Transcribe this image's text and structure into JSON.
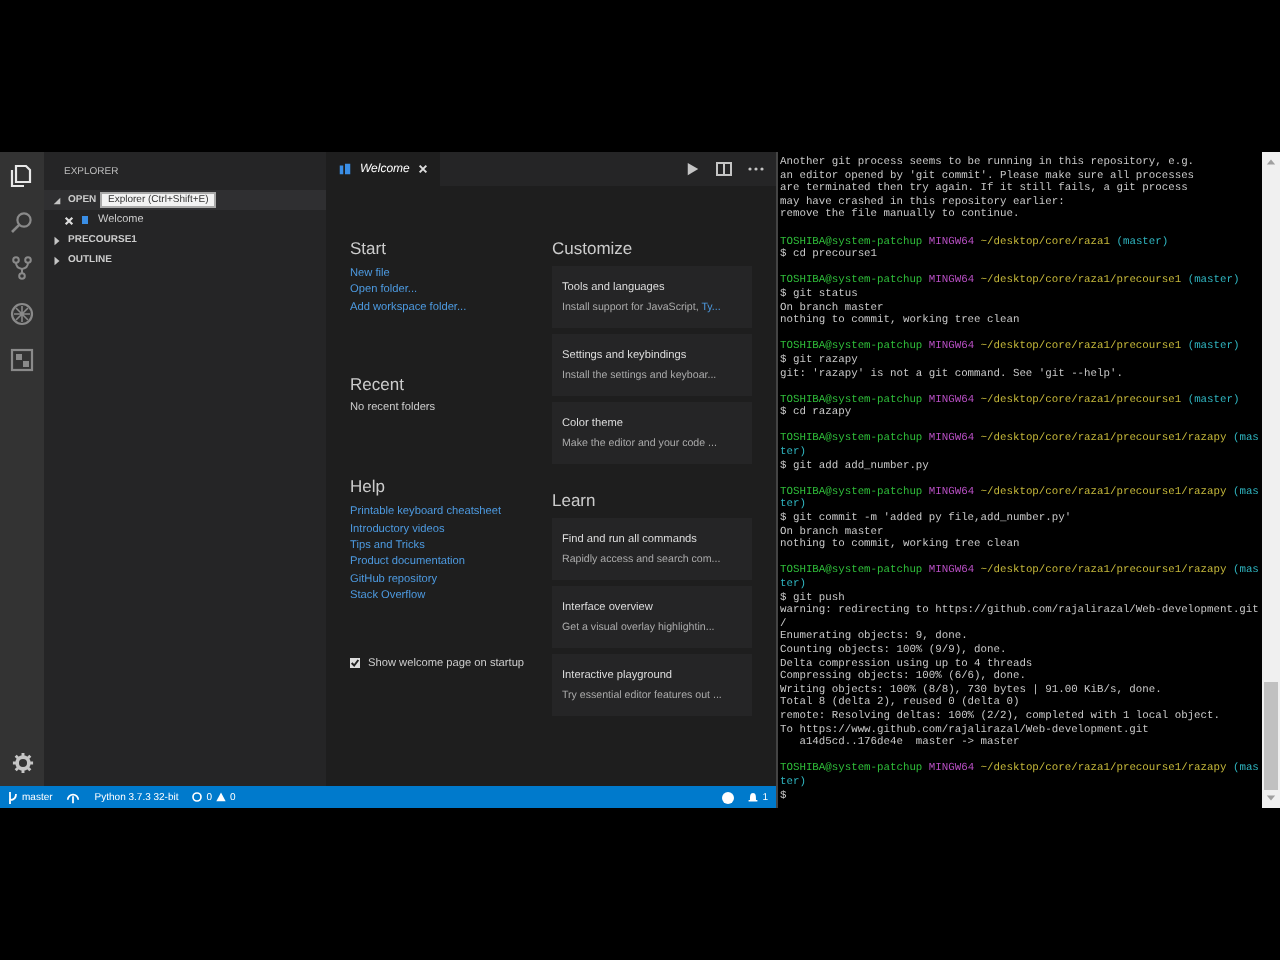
{
  "activity_bar": [
    {
      "kind": "files",
      "selected": true
    },
    {
      "kind": "search",
      "selected": false
    },
    {
      "kind": "source-control",
      "selected": false
    },
    {
      "kind": "debug",
      "selected": false
    },
    {
      "kind": "extensions",
      "selected": false
    }
  ],
  "tooltip": "Explorer (Ctrl+Shift+E)",
  "explorer": {
    "title": "EXPLORER",
    "sections": [
      {
        "label": "OPEN",
        "expanded": true,
        "children": [
          {
            "label": "Welcome"
          }
        ]
      },
      {
        "label": "PRECOURSE1",
        "expanded": false
      },
      {
        "label": "OUTLINE",
        "expanded": false
      }
    ]
  },
  "editor_tab": {
    "label": "Welcome"
  },
  "welcome": {
    "start": {
      "title": "Start",
      "links": [
        "New file",
        "Open folder...",
        "Add workspace folder..."
      ]
    },
    "recent": {
      "title": "Recent",
      "text": "No recent folders"
    },
    "help": {
      "title": "Help",
      "links": [
        "Printable keyboard cheatsheet",
        "Introductory videos",
        "Tips and Tricks",
        "Product documentation",
        "GitHub repository",
        "Stack Overflow"
      ]
    },
    "show_on_startup": {
      "label": "Show welcome page on startup",
      "checked": true
    },
    "customize": {
      "title": "Customize",
      "cards": [
        {
          "title": "Tools and languages",
          "description": "Install support for JavaScript, ",
          "link": "Ty..."
        },
        {
          "title": "Settings and keybindings",
          "description": "Install the settings and keyboar..."
        },
        {
          "title": "Color theme",
          "description": "Make the editor and your code ..."
        }
      ]
    },
    "learn": {
      "title": "Learn",
      "cards": [
        {
          "title": "Find and run all commands",
          "description": "Rapidly access and search com..."
        },
        {
          "title": "Interface overview",
          "description": "Get a visual overlay highlightin..."
        },
        {
          "title": "Interactive playground",
          "description": "Try essential editor features out ..."
        }
      ]
    }
  },
  "status_bar": {
    "branch": "master",
    "python": "Python 3.7.3 32-bit",
    "errors": "0",
    "warnings": "0",
    "notifications": "1"
  },
  "terminal": [
    [
      [
        {
          "kind": "text",
          "text": "Another git process seems to be running in this repository, e.g."
        }
      ],
      [
        {
          "kind": "text",
          "text": "an editor opened by 'git commit'. Please make sure all processes"
        }
      ],
      [
        {
          "kind": "text",
          "text": "are terminated then try again. If it still fails, a git process"
        }
      ],
      [
        {
          "kind": "text",
          "text": "may have crashed in this repository earlier:"
        }
      ],
      [
        {
          "kind": "text",
          "text": "remove the file manually to continue."
        }
      ]
    ],
    [
      [
        {
          "kind": "user",
          "text": "TOSHIBA@system-patchup"
        },
        {
          "kind": "system",
          "text": " MINGW64"
        },
        {
          "kind": "path",
          "text": " ~/desktop/core/raza1"
        },
        {
          "kind": "branch",
          "text": " (master)"
        }
      ],
      [
        {
          "kind": "text",
          "text": "$ cd precourse1"
        }
      ]
    ],
    [
      [
        {
          "kind": "user",
          "text": "TOSHIBA@system-patchup"
        },
        {
          "kind": "system",
          "text": " MINGW64"
        },
        {
          "kind": "path",
          "text": " ~/desktop/core/raza1/precourse1"
        },
        {
          "kind": "branch",
          "text": " (master)"
        }
      ],
      [
        {
          "kind": "text",
          "text": "$ git status"
        }
      ],
      [
        {
          "kind": "text",
          "text": "On branch master"
        }
      ],
      [
        {
          "kind": "text",
          "text": "nothing to commit, working tree clean"
        }
      ]
    ],
    [
      [
        {
          "kind": "user",
          "text": "TOSHIBA@system-patchup"
        },
        {
          "kind": "system",
          "text": " MINGW64"
        },
        {
          "kind": "path",
          "text": " ~/desktop/core/raza1/precourse1"
        },
        {
          "kind": "branch",
          "text": " (master)"
        }
      ],
      [
        {
          "kind": "text",
          "text": "$ git razapy"
        }
      ],
      [
        {
          "kind": "text",
          "text": "git: 'razapy' is not a git command. See 'git --help'."
        }
      ]
    ],
    [
      [
        {
          "kind": "user",
          "text": "TOSHIBA@system-patchup"
        },
        {
          "kind": "system",
          "text": " MINGW64"
        },
        {
          "kind": "path",
          "text": " ~/desktop/core/raza1/precourse1"
        },
        {
          "kind": "branch",
          "text": " (master)"
        }
      ],
      [
        {
          "kind": "text",
          "text": "$ cd razapy"
        }
      ]
    ],
    [
      [
        {
          "kind": "user",
          "text": "TOSHIBA@system-patchup"
        },
        {
          "kind": "system",
          "text": " MINGW64"
        },
        {
          "kind": "path",
          "text": " ~/desktop/core/raza1/precourse1/razapy"
        },
        {
          "kind": "branch",
          "text": " (mas"
        }
      ],
      [
        {
          "kind": "branch",
          "text": "ter)"
        }
      ],
      [
        {
          "kind": "text",
          "text": "$ git add add_number.py"
        }
      ]
    ],
    [
      [
        {
          "kind": "user",
          "text": "TOSHIBA@system-patchup"
        },
        {
          "kind": "system",
          "text": " MINGW64"
        },
        {
          "kind": "path",
          "text": " ~/desktop/core/raza1/precourse1/razapy"
        },
        {
          "kind": "branch",
          "text": " (mas"
        }
      ],
      [
        {
          "kind": "branch",
          "text": "ter)"
        }
      ],
      [
        {
          "kind": "text",
          "text": "$ git commit -m 'added py file,add_number.py'"
        }
      ],
      [
        {
          "kind": "text",
          "text": "On branch master"
        }
      ],
      [
        {
          "kind": "text",
          "text": "nothing to commit, working tree clean"
        }
      ]
    ],
    [
      [
        {
          "kind": "user",
          "text": "TOSHIBA@system-patchup"
        },
        {
          "kind": "system",
          "text": " MINGW64"
        },
        {
          "kind": "path",
          "text": " ~/desktop/core/raza1/precourse1/razapy"
        },
        {
          "kind": "branch",
          "text": " (mas"
        }
      ],
      [
        {
          "kind": "branch",
          "text": "ter)"
        }
      ],
      [
        {
          "kind": "text",
          "text": "$ git push"
        }
      ],
      [
        {
          "kind": "text",
          "text": "warning: redirecting to https://github.com/rajalirazal/Web-development.git"
        }
      ],
      [
        {
          "kind": "text",
          "text": "/"
        }
      ],
      [
        {
          "kind": "text",
          "text": "Enumerating objects: 9, done."
        }
      ],
      [
        {
          "kind": "text",
          "text": "Counting objects: 100% (9/9), done."
        }
      ],
      [
        {
          "kind": "text",
          "text": "Delta compression using up to 4 threads"
        }
      ],
      [
        {
          "kind": "text",
          "text": "Compressing objects: 100% (6/6), done."
        }
      ],
      [
        {
          "kind": "text",
          "text": "Writing objects: 100% (8/8), 730 bytes | 91.00 KiB/s, done."
        }
      ],
      [
        {
          "kind": "text",
          "text": "Total 8 (delta 2), reused 0 (delta 0)"
        }
      ],
      [
        {
          "kind": "text",
          "text": "remote: Resolving deltas: 100% (2/2), completed with 1 local object."
        }
      ],
      [
        {
          "kind": "text",
          "text": "To https://www.github.com/rajalirazal/Web-development.git"
        }
      ],
      [
        {
          "kind": "text",
          "text": "   a14d5cd..176de4e  master -> master"
        }
      ]
    ],
    [
      [
        {
          "kind": "user",
          "text": "TOSHIBA@system-patchup"
        },
        {
          "kind": "system",
          "text": " MINGW64"
        },
        {
          "kind": "path",
          "text": " ~/desktop/core/raza1/precourse1/razapy"
        },
        {
          "kind": "branch",
          "text": " (mas"
        }
      ],
      [
        {
          "kind": "branch",
          "text": "ter)"
        }
      ],
      [
        {
          "kind": "text",
          "text": "$"
        }
      ]
    ]
  ]
}
